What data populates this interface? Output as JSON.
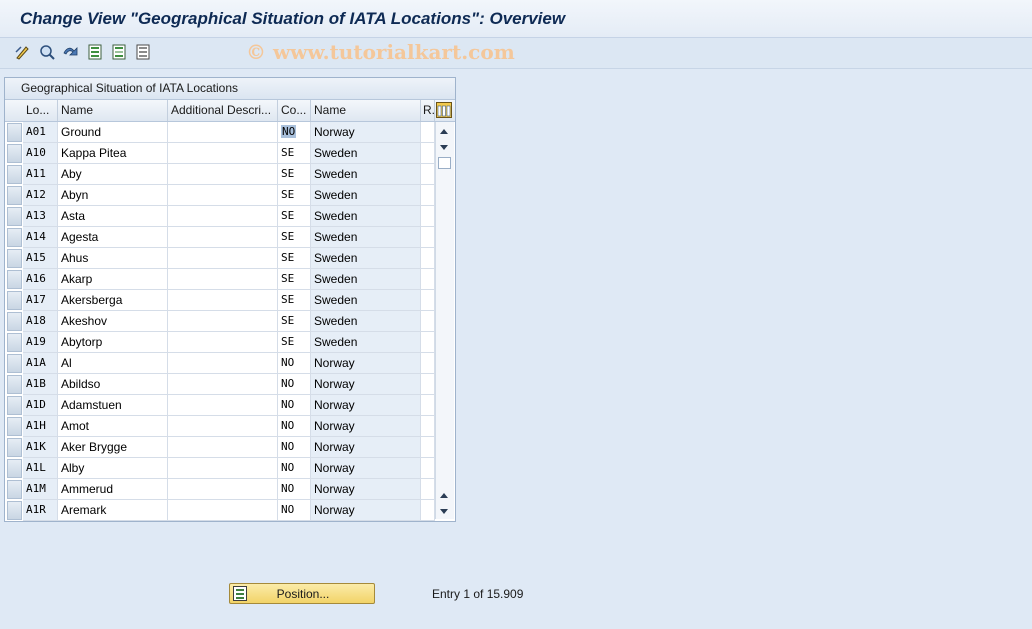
{
  "window": {
    "title": "Change View \"Geographical Situation of IATA Locations\": Overview"
  },
  "watermark": "© www.tutorialkart.com",
  "toolbar": {
    "icons": [
      "display-change-icon",
      "find-icon",
      "other-view-icon",
      "select-all-icon",
      "select-block-icon",
      "deselect-all-icon"
    ]
  },
  "table": {
    "title": "Geographical Situation of IATA Locations",
    "columns": [
      "Lo...",
      "Name",
      "Additional Descri...",
      "Co...",
      "Name",
      "R."
    ],
    "rows": [
      {
        "loc": "A01",
        "name": "Ground",
        "add": "",
        "co": "NO",
        "cname": "Norway"
      },
      {
        "loc": "A10",
        "name": "Kappa Pitea",
        "add": "",
        "co": "SE",
        "cname": "Sweden"
      },
      {
        "loc": "A11",
        "name": "Aby",
        "add": "",
        "co": "SE",
        "cname": "Sweden"
      },
      {
        "loc": "A12",
        "name": "Abyn",
        "add": "",
        "co": "SE",
        "cname": "Sweden"
      },
      {
        "loc": "A13",
        "name": "Asta",
        "add": "",
        "co": "SE",
        "cname": "Sweden"
      },
      {
        "loc": "A14",
        "name": "Agesta",
        "add": "",
        "co": "SE",
        "cname": "Sweden"
      },
      {
        "loc": "A15",
        "name": "Ahus",
        "add": "",
        "co": "SE",
        "cname": "Sweden"
      },
      {
        "loc": "A16",
        "name": "Akarp",
        "add": "",
        "co": "SE",
        "cname": "Sweden"
      },
      {
        "loc": "A17",
        "name": "Akersberga",
        "add": "",
        "co": "SE",
        "cname": "Sweden"
      },
      {
        "loc": "A18",
        "name": "Akeshov",
        "add": "",
        "co": "SE",
        "cname": "Sweden"
      },
      {
        "loc": "A19",
        "name": "Abytorp",
        "add": "",
        "co": "SE",
        "cname": "Sweden"
      },
      {
        "loc": "A1A",
        "name": "Al",
        "add": "",
        "co": "NO",
        "cname": "Norway"
      },
      {
        "loc": "A1B",
        "name": "Abildso",
        "add": "",
        "co": "NO",
        "cname": "Norway"
      },
      {
        "loc": "A1D",
        "name": "Adamstuen",
        "add": "",
        "co": "NO",
        "cname": "Norway"
      },
      {
        "loc": "A1H",
        "name": "Amot",
        "add": "",
        "co": "NO",
        "cname": "Norway"
      },
      {
        "loc": "A1K",
        "name": "Aker Brygge",
        "add": "",
        "co": "NO",
        "cname": "Norway"
      },
      {
        "loc": "A1L",
        "name": "Alby",
        "add": "",
        "co": "NO",
        "cname": "Norway"
      },
      {
        "loc": "A1M",
        "name": "Ammerud",
        "add": "",
        "co": "NO",
        "cname": "Norway"
      },
      {
        "loc": "A1R",
        "name": "Aremark",
        "add": "",
        "co": "NO",
        "cname": "Norway"
      }
    ]
  },
  "footer": {
    "position_label": "Position...",
    "entry_text": "Entry 1 of 15.909"
  }
}
